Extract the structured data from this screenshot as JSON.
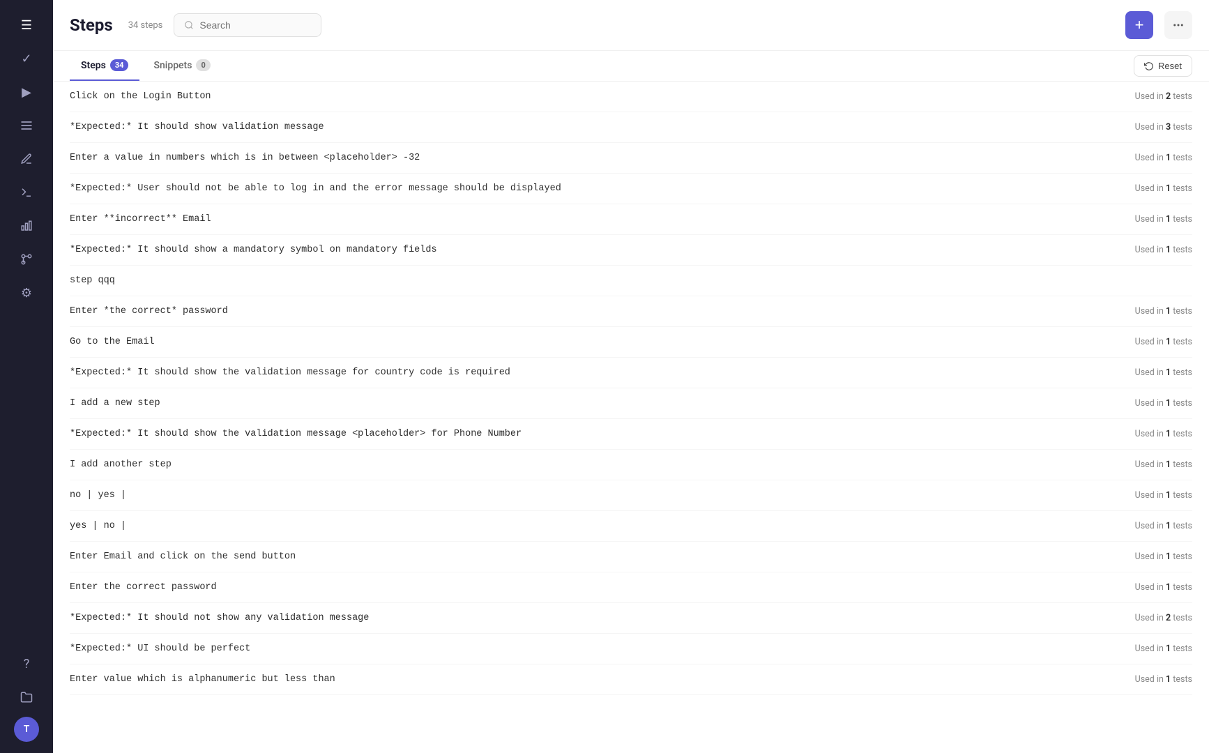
{
  "sidebar": {
    "items": [
      {
        "name": "menu-icon",
        "icon": "☰",
        "active": true
      },
      {
        "name": "check-icon",
        "icon": "✓",
        "active": false
      },
      {
        "name": "play-icon",
        "icon": "▶",
        "active": false
      },
      {
        "name": "list-icon",
        "icon": "≡",
        "active": false
      },
      {
        "name": "pen-icon",
        "icon": "✏",
        "active": false
      },
      {
        "name": "terminal-icon",
        "icon": "⌨",
        "active": false
      },
      {
        "name": "chart-icon",
        "icon": "📊",
        "active": false
      },
      {
        "name": "branch-icon",
        "icon": "⑂",
        "active": false
      },
      {
        "name": "gear-icon",
        "icon": "⚙",
        "active": false
      },
      {
        "name": "help-icon",
        "icon": "?",
        "active": false
      },
      {
        "name": "folder-icon",
        "icon": "📁",
        "active": false
      }
    ],
    "avatar_label": "T"
  },
  "header": {
    "title": "Steps",
    "subtitle": "34 steps",
    "search_placeholder": "Search",
    "add_button_label": "+",
    "more_button_label": "···"
  },
  "tabs": [
    {
      "label": "Steps",
      "badge": "34",
      "active": true
    },
    {
      "label": "Snippets",
      "badge": "0",
      "active": false
    }
  ],
  "reset_button": "Reset",
  "steps": [
    {
      "text": "Click on the Login Button",
      "usage": "Used in 2 tests"
    },
    {
      "text": "*Expected:* It should show validation message",
      "usage": "Used in 3 tests"
    },
    {
      "text": "Enter a value in numbers which is in between <placeholder> -32",
      "usage": "Used in 1 tests"
    },
    {
      "text": "*Expected:* User should not be able to log in and the error message should be displayed",
      "usage": "Used in 1 tests"
    },
    {
      "text": "Enter **incorrect** Email",
      "usage": "Used in 1 tests"
    },
    {
      "text": "*Expected:* It should show a mandatory symbol on mandatory fields",
      "usage": "Used in 1 tests"
    },
    {
      "text": "step qqq",
      "usage": ""
    },
    {
      "text": "Enter *the correct* password",
      "usage": "Used in 1 tests"
    },
    {
      "text": "Go to the Email",
      "usage": "Used in 1 tests"
    },
    {
      "text": "*Expected:* It should show the validation message for country code is required",
      "usage": "Used in 1 tests"
    },
    {
      "text": "I add a new step",
      "usage": "Used in 1 tests"
    },
    {
      "text": "*Expected:* It should show the validation message <placeholder> for Phone Number",
      "usage": "Used in 1 tests"
    },
    {
      "text": "I add another step",
      "usage": "Used in 1 tests"
    },
    {
      "text": "no | yes |",
      "usage": "Used in 1 tests"
    },
    {
      "text": "yes | no |",
      "usage": "Used in 1 tests"
    },
    {
      "text": "Enter Email and click on the send button",
      "usage": "Used in 1 tests"
    },
    {
      "text": "Enter the correct password",
      "usage": "Used in 1 tests"
    },
    {
      "text": "*Expected:* It should not show any validation message",
      "usage": "Used in 2 tests"
    },
    {
      "text": "*Expected:* UI should be perfect",
      "usage": "Used in 1 tests"
    },
    {
      "text": "Enter value which is alphanumeric but less than",
      "usage": "Used in 1 tests"
    }
  ]
}
